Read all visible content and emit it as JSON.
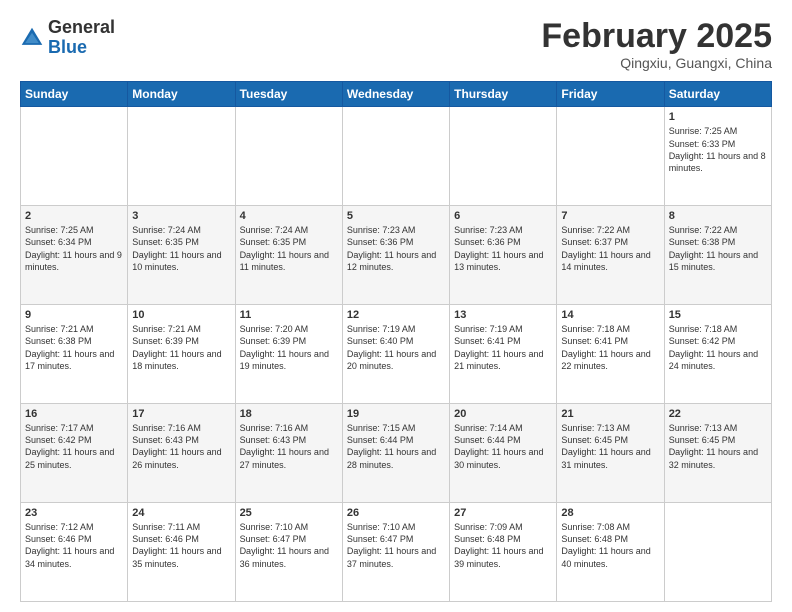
{
  "header": {
    "logo_general": "General",
    "logo_blue": "Blue",
    "month_title": "February 2025",
    "subtitle": "Qingxiu, Guangxi, China"
  },
  "weekdays": [
    "Sunday",
    "Monday",
    "Tuesday",
    "Wednesday",
    "Thursday",
    "Friday",
    "Saturday"
  ],
  "weeks": [
    [
      {
        "day": "",
        "info": ""
      },
      {
        "day": "",
        "info": ""
      },
      {
        "day": "",
        "info": ""
      },
      {
        "day": "",
        "info": ""
      },
      {
        "day": "",
        "info": ""
      },
      {
        "day": "",
        "info": ""
      },
      {
        "day": "1",
        "info": "Sunrise: 7:25 AM\nSunset: 6:33 PM\nDaylight: 11 hours and 8 minutes."
      }
    ],
    [
      {
        "day": "2",
        "info": "Sunrise: 7:25 AM\nSunset: 6:34 PM\nDaylight: 11 hours and 9 minutes."
      },
      {
        "day": "3",
        "info": "Sunrise: 7:24 AM\nSunset: 6:35 PM\nDaylight: 11 hours and 10 minutes."
      },
      {
        "day": "4",
        "info": "Sunrise: 7:24 AM\nSunset: 6:35 PM\nDaylight: 11 hours and 11 minutes."
      },
      {
        "day": "5",
        "info": "Sunrise: 7:23 AM\nSunset: 6:36 PM\nDaylight: 11 hours and 12 minutes."
      },
      {
        "day": "6",
        "info": "Sunrise: 7:23 AM\nSunset: 6:36 PM\nDaylight: 11 hours and 13 minutes."
      },
      {
        "day": "7",
        "info": "Sunrise: 7:22 AM\nSunset: 6:37 PM\nDaylight: 11 hours and 14 minutes."
      },
      {
        "day": "8",
        "info": "Sunrise: 7:22 AM\nSunset: 6:38 PM\nDaylight: 11 hours and 15 minutes."
      }
    ],
    [
      {
        "day": "9",
        "info": "Sunrise: 7:21 AM\nSunset: 6:38 PM\nDaylight: 11 hours and 17 minutes."
      },
      {
        "day": "10",
        "info": "Sunrise: 7:21 AM\nSunset: 6:39 PM\nDaylight: 11 hours and 18 minutes."
      },
      {
        "day": "11",
        "info": "Sunrise: 7:20 AM\nSunset: 6:39 PM\nDaylight: 11 hours and 19 minutes."
      },
      {
        "day": "12",
        "info": "Sunrise: 7:19 AM\nSunset: 6:40 PM\nDaylight: 11 hours and 20 minutes."
      },
      {
        "day": "13",
        "info": "Sunrise: 7:19 AM\nSunset: 6:41 PM\nDaylight: 11 hours and 21 minutes."
      },
      {
        "day": "14",
        "info": "Sunrise: 7:18 AM\nSunset: 6:41 PM\nDaylight: 11 hours and 22 minutes."
      },
      {
        "day": "15",
        "info": "Sunrise: 7:18 AM\nSunset: 6:42 PM\nDaylight: 11 hours and 24 minutes."
      }
    ],
    [
      {
        "day": "16",
        "info": "Sunrise: 7:17 AM\nSunset: 6:42 PM\nDaylight: 11 hours and 25 minutes."
      },
      {
        "day": "17",
        "info": "Sunrise: 7:16 AM\nSunset: 6:43 PM\nDaylight: 11 hours and 26 minutes."
      },
      {
        "day": "18",
        "info": "Sunrise: 7:16 AM\nSunset: 6:43 PM\nDaylight: 11 hours and 27 minutes."
      },
      {
        "day": "19",
        "info": "Sunrise: 7:15 AM\nSunset: 6:44 PM\nDaylight: 11 hours and 28 minutes."
      },
      {
        "day": "20",
        "info": "Sunrise: 7:14 AM\nSunset: 6:44 PM\nDaylight: 11 hours and 30 minutes."
      },
      {
        "day": "21",
        "info": "Sunrise: 7:13 AM\nSunset: 6:45 PM\nDaylight: 11 hours and 31 minutes."
      },
      {
        "day": "22",
        "info": "Sunrise: 7:13 AM\nSunset: 6:45 PM\nDaylight: 11 hours and 32 minutes."
      }
    ],
    [
      {
        "day": "23",
        "info": "Sunrise: 7:12 AM\nSunset: 6:46 PM\nDaylight: 11 hours and 34 minutes."
      },
      {
        "day": "24",
        "info": "Sunrise: 7:11 AM\nSunset: 6:46 PM\nDaylight: 11 hours and 35 minutes."
      },
      {
        "day": "25",
        "info": "Sunrise: 7:10 AM\nSunset: 6:47 PM\nDaylight: 11 hours and 36 minutes."
      },
      {
        "day": "26",
        "info": "Sunrise: 7:10 AM\nSunset: 6:47 PM\nDaylight: 11 hours and 37 minutes."
      },
      {
        "day": "27",
        "info": "Sunrise: 7:09 AM\nSunset: 6:48 PM\nDaylight: 11 hours and 39 minutes."
      },
      {
        "day": "28",
        "info": "Sunrise: 7:08 AM\nSunset: 6:48 PM\nDaylight: 11 hours and 40 minutes."
      },
      {
        "day": "",
        "info": ""
      }
    ]
  ]
}
